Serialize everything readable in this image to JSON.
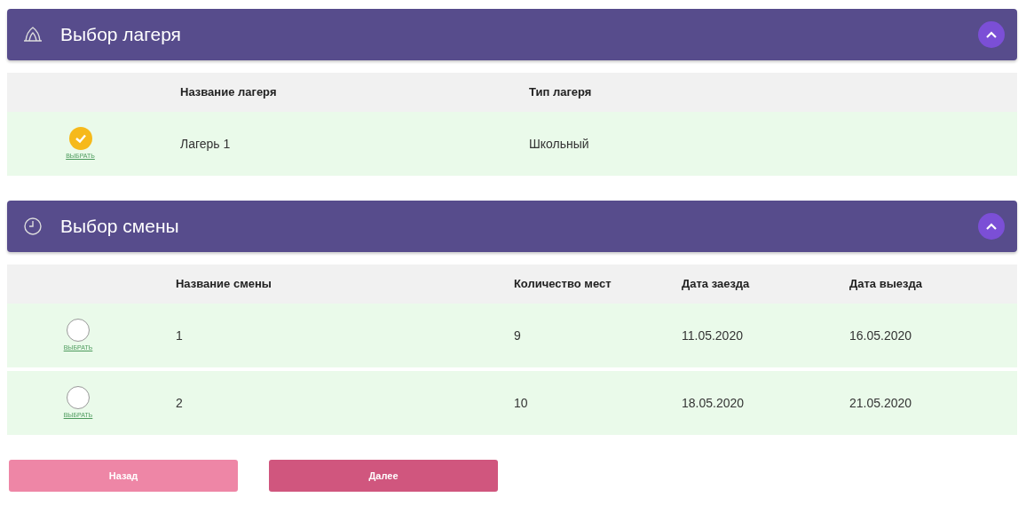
{
  "sections": [
    {
      "title": "Выбор лагеря",
      "kind": "tent",
      "expanded": true,
      "columns": [
        "Название лагеря",
        "Тип лагеря"
      ],
      "rows": [
        {
          "selected": true,
          "select_label": "ВЫБРАТЬ",
          "cells": [
            "Лагерь 1",
            "Школьный"
          ]
        }
      ]
    },
    {
      "title": "Выбор смены",
      "kind": "clock",
      "expanded": true,
      "columns": [
        "Название смены",
        "Количество мест",
        "Дата заезда",
        "Дата выезда"
      ],
      "rows": [
        {
          "selected": false,
          "select_label": "ВЫБРАТЬ",
          "cells": [
            "1",
            "9",
            "11.05.2020",
            "16.05.2020"
          ]
        },
        {
          "selected": false,
          "select_label": "ВЫБРАТЬ",
          "cells": [
            "2",
            "10",
            "18.05.2020",
            "21.05.2020"
          ]
        }
      ]
    }
  ],
  "buttons": [
    {
      "label": "Назад",
      "kind": "secondary"
    },
    {
      "label": "Далее",
      "kind": "primary"
    }
  ]
}
